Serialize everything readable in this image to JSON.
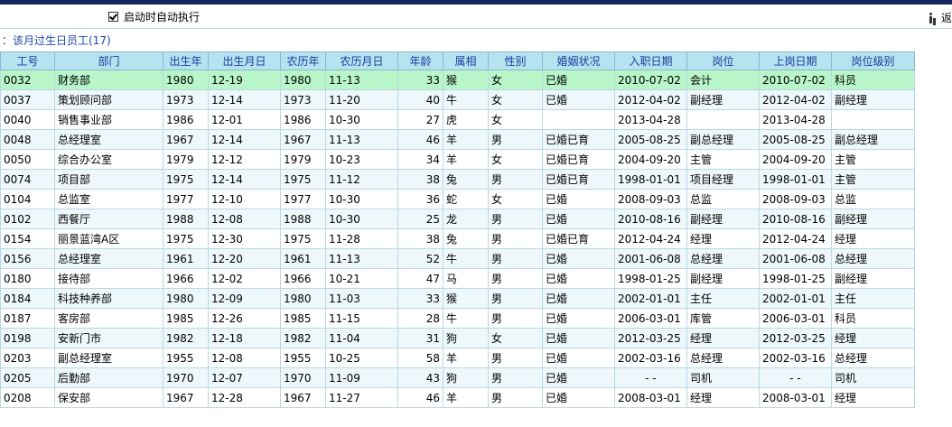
{
  "toolbar": {
    "autorun_label": "启动时自动执行",
    "autorun_checked": true,
    "return_label": "返"
  },
  "section": {
    "title": "：该月过生日员工(17)"
  },
  "table": {
    "columns": [
      "工号",
      "部门",
      "出生年",
      "出生月日",
      "农历年",
      "农历月日",
      "年龄",
      "属相",
      "性别",
      "婚姻状况",
      "入职日期",
      "岗位",
      "上岗日期",
      "岗位级别"
    ],
    "rows": [
      [
        "0032",
        "财务部",
        "1980",
        "12-19",
        "1980",
        "11-13",
        "33",
        "猴",
        "女",
        "已婚",
        "2010-07-02",
        "会计",
        "2010-07-02",
        "科员"
      ],
      [
        "0037",
        "策划顾问部",
        "1973",
        "12-14",
        "1973",
        "11-20",
        "40",
        "牛",
        "女",
        "已婚",
        "2012-04-02",
        "副经理",
        "2012-04-02",
        "副经理"
      ],
      [
        "0040",
        "销售事业部",
        "1986",
        "12-01",
        "1986",
        "10-30",
        "27",
        "虎",
        "女",
        "",
        "2013-04-28",
        "",
        "2013-04-28",
        ""
      ],
      [
        "0048",
        "总经理室",
        "1967",
        "12-14",
        "1967",
        "11-13",
        "46",
        "羊",
        "男",
        "已婚已育",
        "2005-08-25",
        "副总经理",
        "2005-08-25",
        "副总经理"
      ],
      [
        "0050",
        "综合办公室",
        "1979",
        "12-12",
        "1979",
        "10-23",
        "34",
        "羊",
        "女",
        "已婚已育",
        "2004-09-20",
        "主管",
        "2004-09-20",
        "主管"
      ],
      [
        "0074",
        "项目部",
        "1975",
        "12-14",
        "1975",
        "11-12",
        "38",
        "兔",
        "男",
        "已婚已育",
        "1998-01-01",
        "项目经理",
        "1998-01-01",
        "主管"
      ],
      [
        "0104",
        "总监室",
        "1977",
        "12-10",
        "1977",
        "10-30",
        "36",
        "蛇",
        "女",
        "已婚",
        "2008-09-03",
        "总监",
        "2008-09-03",
        "总监"
      ],
      [
        "0102",
        "西餐厅",
        "1988",
        "12-08",
        "1988",
        "10-30",
        "25",
        "龙",
        "男",
        "已婚",
        "2010-08-16",
        "副经理",
        "2010-08-16",
        "副经理"
      ],
      [
        "0154",
        "丽景蓝湾A区",
        "1975",
        "12-30",
        "1975",
        "11-28",
        "38",
        "兔",
        "男",
        "已婚已育",
        "2012-04-24",
        "经理",
        "2012-04-24",
        "经理"
      ],
      [
        "0156",
        "总经理室",
        "1961",
        "12-20",
        "1961",
        "11-13",
        "52",
        "牛",
        "男",
        "已婚",
        "2001-06-08",
        "总经理",
        "2001-06-08",
        "总经理"
      ],
      [
        "0180",
        "接待部",
        "1966",
        "12-02",
        "1966",
        "10-21",
        "47",
        "马",
        "男",
        "已婚",
        "1998-01-25",
        "副经理",
        "1998-01-25",
        "副经理"
      ],
      [
        "0184",
        "科技种养部",
        "1980",
        "12-09",
        "1980",
        "11-03",
        "33",
        "猴",
        "男",
        "已婚",
        "2002-01-01",
        "主任",
        "2002-01-01",
        "主任"
      ],
      [
        "0187",
        "客房部",
        "1985",
        "12-26",
        "1985",
        "11-15",
        "28",
        "牛",
        "男",
        "已婚",
        "2006-03-01",
        "库管",
        "2006-03-01",
        "科员"
      ],
      [
        "0198",
        "安新门市",
        "1982",
        "12-18",
        "1982",
        "11-04",
        "31",
        "狗",
        "女",
        "已婚",
        "2012-03-25",
        "经理",
        "2012-03-25",
        "经理"
      ],
      [
        "0203",
        "副总经理室",
        "1955",
        "12-08",
        "1955",
        "10-25",
        "58",
        "羊",
        "男",
        "已婚",
        "2002-03-16",
        "总经理",
        "2002-03-16",
        "总经理"
      ],
      [
        "0205",
        "后勤部",
        "1970",
        "12-07",
        "1970",
        "11-09",
        "43",
        "狗",
        "男",
        "已婚",
        "- -",
        "司机",
        "- -",
        "司机"
      ],
      [
        "0208",
        "保安部",
        "1967",
        "12-28",
        "1967",
        "11-27",
        "46",
        "羊",
        "男",
        "已婚",
        "2008-03-01",
        "经理",
        "2008-03-01",
        "经理"
      ]
    ],
    "selected_row": 0
  },
  "colors": {
    "top_bar": "#14255e",
    "header_bg": "#b5e3f0",
    "header_text": "#1a3c9c",
    "selected_row": "#b8f5c8",
    "alt_row": "#eef8fb",
    "title_text": "#1a4aa8"
  }
}
